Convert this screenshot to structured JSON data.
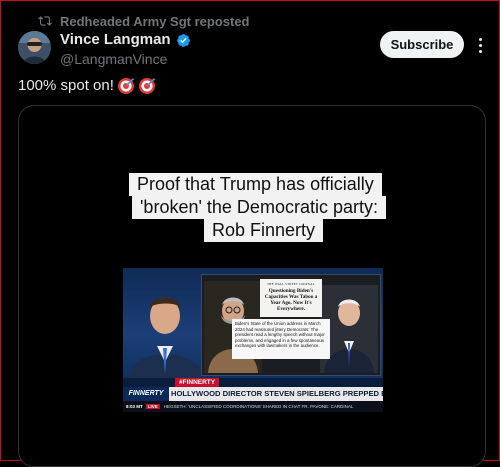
{
  "repost": {
    "text": "Redheaded Army Sgt reposted"
  },
  "author": {
    "name": "Vince Langman",
    "handle": "@LangmanVince"
  },
  "buttons": {
    "subscribe": "Subscribe"
  },
  "post": {
    "text": "100% spot on!"
  },
  "media": {
    "caption_lines": [
      "Proof that Trump has officially",
      "'broken' the Democratic party:",
      "Rob Finnerty"
    ],
    "news": {
      "wsj_masthead": "THE WALL STREET JOURNAL",
      "wsj_headline": "Questioning Biden's Capacities Was Taboo a Year Ago. Now It's Everywhere.",
      "quote": "Biden's State of the Union address in March 2024 had reassured jittery Democrats: The president read a lengthy speech without major problems, and engaged in a few spontaneous exchanges with lawmakers in the audience.",
      "hashtag": "#FINNERTY",
      "brand": "FINNERTY",
      "chyron": "HOLLYWOOD DIRECTOR STEVEN SPIELBERG PREPPED BIDEN FOR DEBATE",
      "ticker_time": "8:03 MT",
      "ticker_live": "LIVE",
      "ticker_text": "HEGSETH: 'UNCLASSIFIED COORDINATIONS' SHARED IN CHAT    FR. PAVONE: CARDINAL"
    }
  },
  "colors": {
    "background": "#000000",
    "text": "#e7e9ea",
    "muted": "#71767b",
    "verified": "#1d9bf0",
    "border": "#2f3336"
  }
}
